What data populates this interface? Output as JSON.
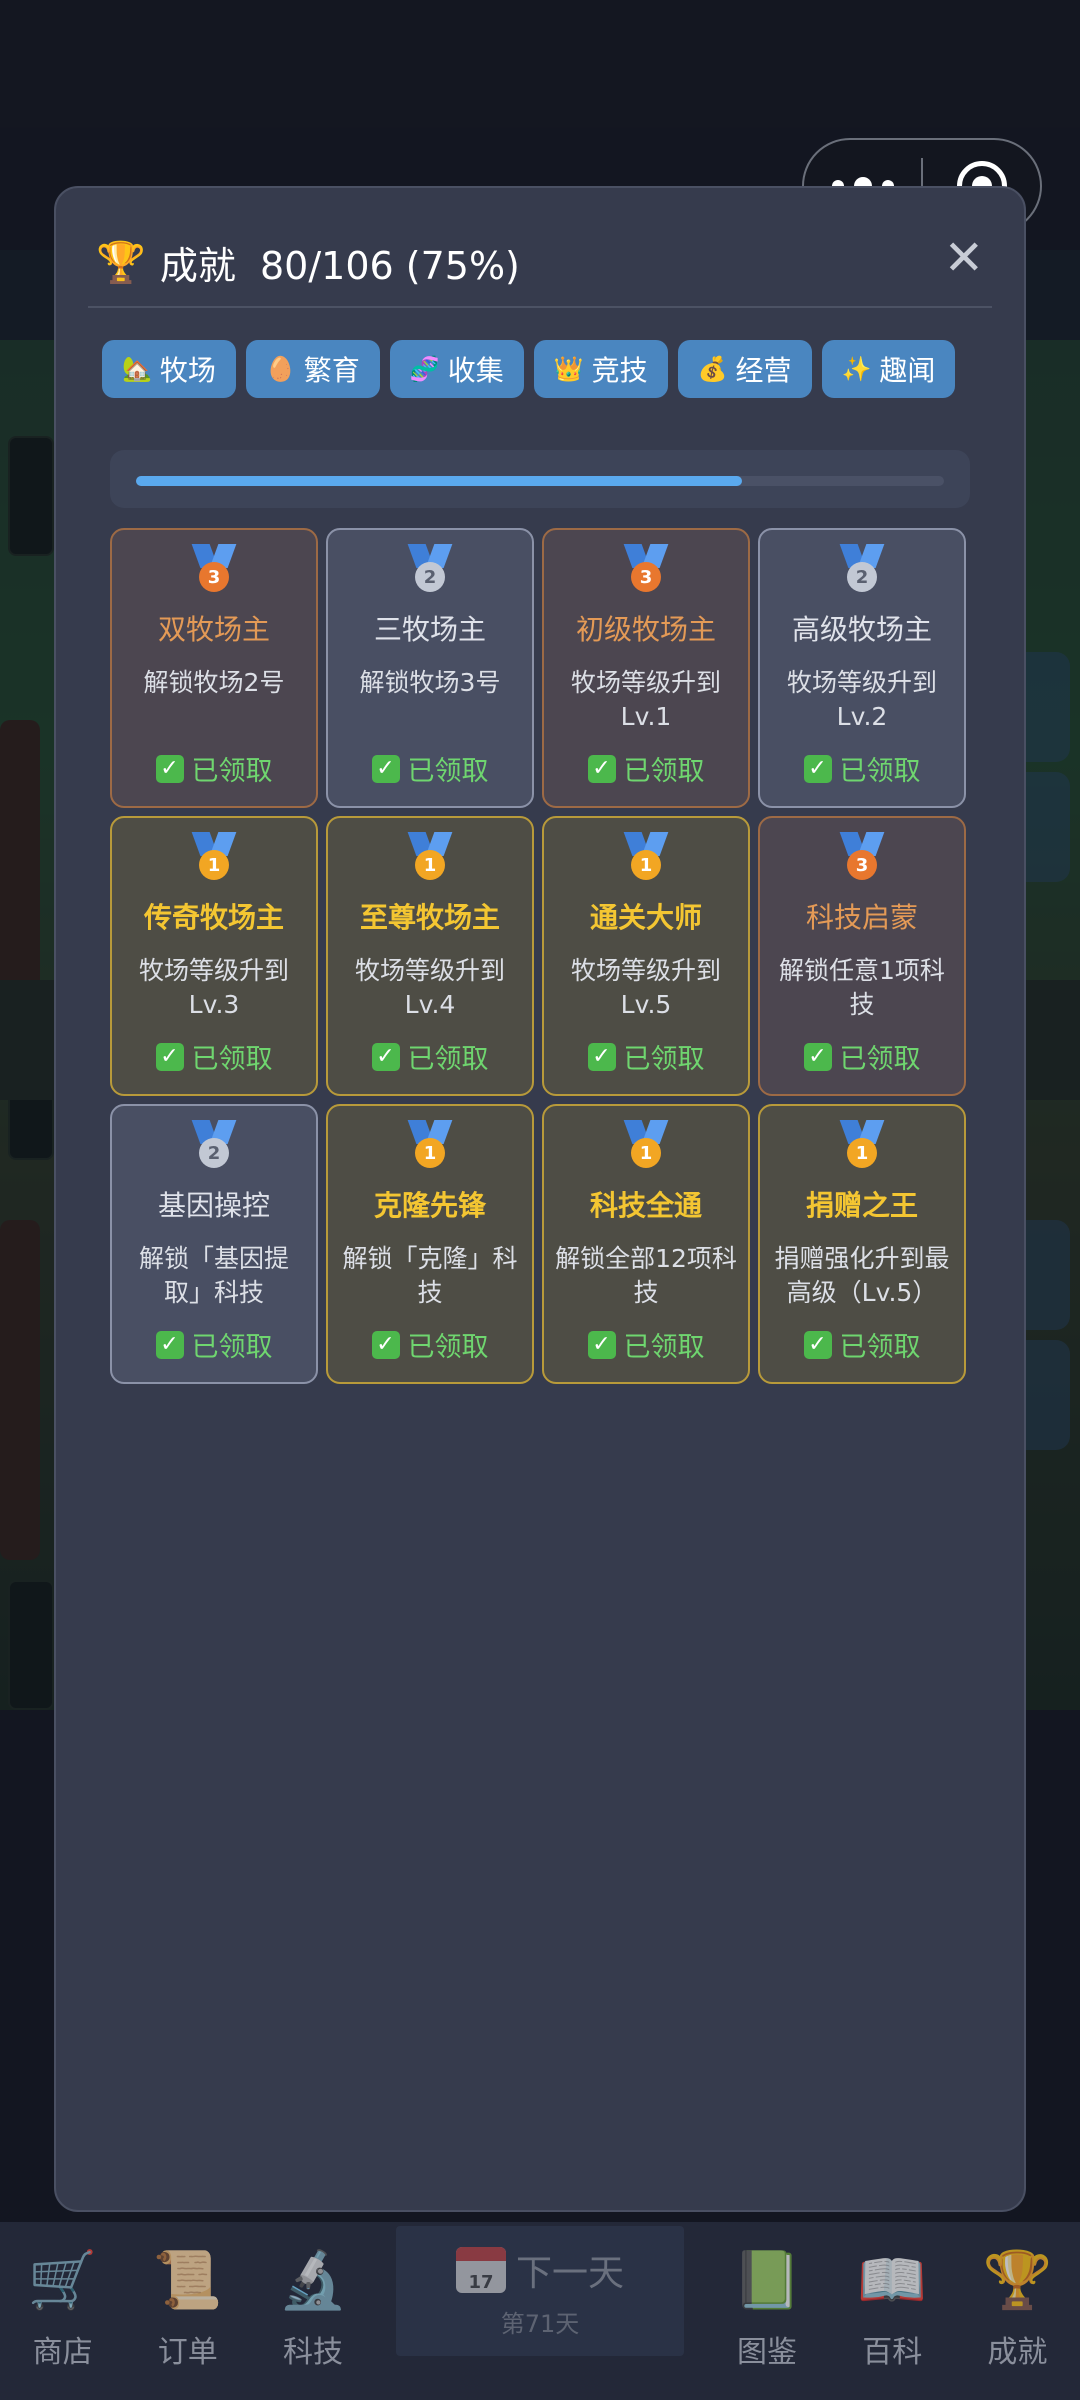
{
  "capsule": {
    "menu_icon": "more-dots-icon",
    "close_icon": "target-circle-icon"
  },
  "modal": {
    "title_icon": "trophy-icon",
    "title_label": "成就",
    "title_count": "80/106 (75%)",
    "close_label": "✕",
    "progress_fraction": 0.75
  },
  "tabs": [
    {
      "icon": "🏡",
      "label": "牧场"
    },
    {
      "icon": "🥚",
      "label": "繁育"
    },
    {
      "icon": "🧬",
      "label": "收集"
    },
    {
      "icon": "👑",
      "label": "竞技"
    },
    {
      "icon": "💰",
      "label": "经营"
    },
    {
      "icon": "✨",
      "label": "趣闻"
    }
  ],
  "achievements": [
    {
      "tier": "bronze",
      "rank": "3",
      "title": "双牧场主",
      "desc": "解锁牧场2号",
      "status": "已领取"
    },
    {
      "tier": "silver",
      "rank": "2",
      "title": "三牧场主",
      "desc": "解锁牧场3号",
      "status": "已领取"
    },
    {
      "tier": "bronze",
      "rank": "3",
      "title": "初级牧场主",
      "desc": "牧场等级升到Lv.1",
      "status": "已领取"
    },
    {
      "tier": "silver",
      "rank": "2",
      "title": "高级牧场主",
      "desc": "牧场等级升到Lv.2",
      "status": "已领取"
    },
    {
      "tier": "gold",
      "rank": "1",
      "title": "传奇牧场主",
      "desc": "牧场等级升到Lv.3",
      "status": "已领取"
    },
    {
      "tier": "gold",
      "rank": "1",
      "title": "至尊牧场主",
      "desc": "牧场等级升到Lv.4",
      "status": "已领取"
    },
    {
      "tier": "gold",
      "rank": "1",
      "title": "通关大师",
      "desc": "牧场等级升到Lv.5",
      "status": "已领取"
    },
    {
      "tier": "bronze",
      "rank": "3",
      "title": "科技启蒙",
      "desc": "解锁任意1项科技",
      "status": "已领取"
    },
    {
      "tier": "silver",
      "rank": "2",
      "title": "基因操控",
      "desc": "解锁「基因提取」科技",
      "status": "已领取"
    },
    {
      "tier": "gold",
      "rank": "1",
      "title": "克隆先锋",
      "desc": "解锁「克隆」科技",
      "status": "已领取"
    },
    {
      "tier": "gold",
      "rank": "1",
      "title": "科技全通",
      "desc": "解锁全部12项科技",
      "status": "已领取"
    },
    {
      "tier": "gold",
      "rank": "1",
      "title": "捐赠之王",
      "desc": "捐赠强化升到最高级（Lv.5）",
      "status": "已领取"
    }
  ],
  "bottom_nav": {
    "items_left": [
      {
        "icon": "🛒",
        "label": "商店",
        "name": "shop"
      },
      {
        "icon": "📜",
        "label": "订单",
        "name": "orders"
      },
      {
        "icon": "🔬",
        "label": "科技",
        "name": "tech"
      }
    ],
    "center": {
      "icon": "calendar-icon",
      "calendar_day": "17",
      "label": "下一天",
      "sub": "第71天"
    },
    "items_right": [
      {
        "icon": "📗",
        "label": "图鉴",
        "name": "codex"
      },
      {
        "icon": "📖",
        "label": "百科",
        "name": "wiki"
      },
      {
        "icon": "🏆",
        "label": "成就",
        "name": "achievements"
      }
    ]
  },
  "colors": {
    "tab_bg": "#4a86c0",
    "progress_fill": "#5aa9ee",
    "gold_title": "#f4c632",
    "bronze_title": "#e49a56",
    "claimed_green": "#6fd66f"
  }
}
